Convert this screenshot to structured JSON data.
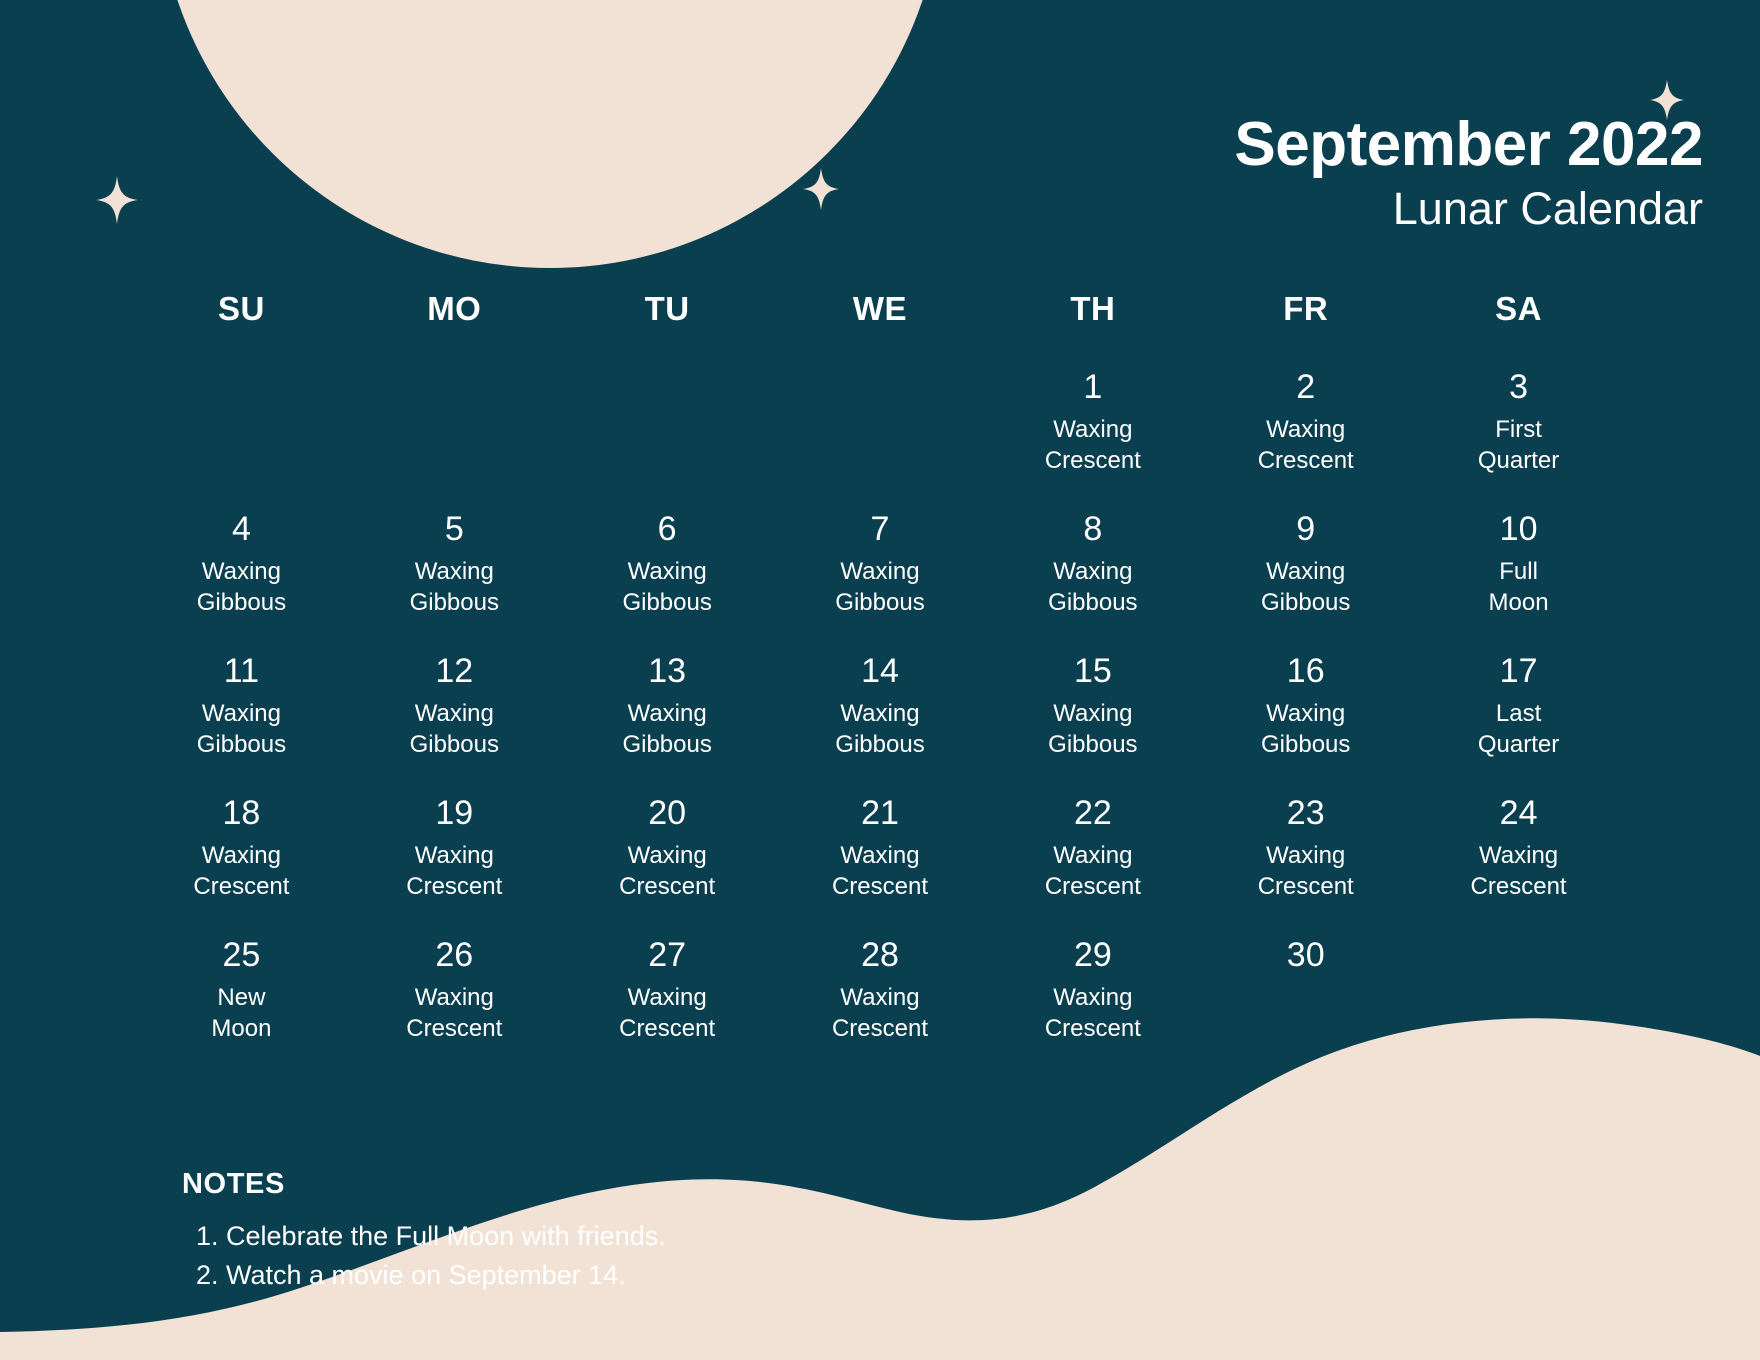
{
  "header": {
    "title": "September 2022",
    "subtitle": "Lunar Calendar"
  },
  "colors": {
    "background": "#0a3f50",
    "moon_light": "#f2e2d5",
    "moon_crater": "#b0a396",
    "text": "#ffffff",
    "star": "#f2e2d5"
  },
  "calendar": {
    "weekday_headers": [
      "SU",
      "MO",
      "TU",
      "WE",
      "TH",
      "FR",
      "SA"
    ],
    "weeks": [
      [
        {
          "day": "",
          "phase": ""
        },
        {
          "day": "",
          "phase": ""
        },
        {
          "day": "",
          "phase": ""
        },
        {
          "day": "",
          "phase": ""
        },
        {
          "day": "1",
          "phase": "Waxing\nCrescent"
        },
        {
          "day": "2",
          "phase": "Waxing\nCrescent"
        },
        {
          "day": "3",
          "phase": "First\nQuarter"
        }
      ],
      [
        {
          "day": "4",
          "phase": "Waxing\nGibbous"
        },
        {
          "day": "5",
          "phase": "Waxing\nGibbous"
        },
        {
          "day": "6",
          "phase": "Waxing\nGibbous"
        },
        {
          "day": "7",
          "phase": "Waxing\nGibbous"
        },
        {
          "day": "8",
          "phase": "Waxing\nGibbous"
        },
        {
          "day": "9",
          "phase": "Waxing\nGibbous"
        },
        {
          "day": "10",
          "phase": "Full\nMoon"
        }
      ],
      [
        {
          "day": "11",
          "phase": "Waxing\nGibbous"
        },
        {
          "day": "12",
          "phase": "Waxing\nGibbous"
        },
        {
          "day": "13",
          "phase": "Waxing\nGibbous"
        },
        {
          "day": "14",
          "phase": "Waxing\nGibbous"
        },
        {
          "day": "15",
          "phase": "Waxing\nGibbous"
        },
        {
          "day": "16",
          "phase": "Waxing\nGibbous"
        },
        {
          "day": "17",
          "phase": "Last\nQuarter"
        }
      ],
      [
        {
          "day": "18",
          "phase": "Waxing\nCrescent"
        },
        {
          "day": "19",
          "phase": "Waxing\nCrescent"
        },
        {
          "day": "20",
          "phase": "Waxing\nCrescent"
        },
        {
          "day": "21",
          "phase": "Waxing\nCrescent"
        },
        {
          "day": "22",
          "phase": "Waxing\nCrescent"
        },
        {
          "day": "23",
          "phase": "Waxing\nCrescent"
        },
        {
          "day": "24",
          "phase": "Waxing\nCrescent"
        }
      ],
      [
        {
          "day": "25",
          "phase": "New\nMoon"
        },
        {
          "day": "26",
          "phase": "Waxing\nCrescent"
        },
        {
          "day": "27",
          "phase": "Waxing\nCrescent"
        },
        {
          "day": "28",
          "phase": "Waxing\nCrescent"
        },
        {
          "day": "29",
          "phase": "Waxing\nCrescent"
        },
        {
          "day": "30",
          "phase": ""
        },
        {
          "day": "",
          "phase": ""
        }
      ]
    ]
  },
  "notes": {
    "title": "NOTES",
    "items": [
      "1. Celebrate the Full Moon with friends.",
      "2. Watch a movie on September 14."
    ]
  }
}
